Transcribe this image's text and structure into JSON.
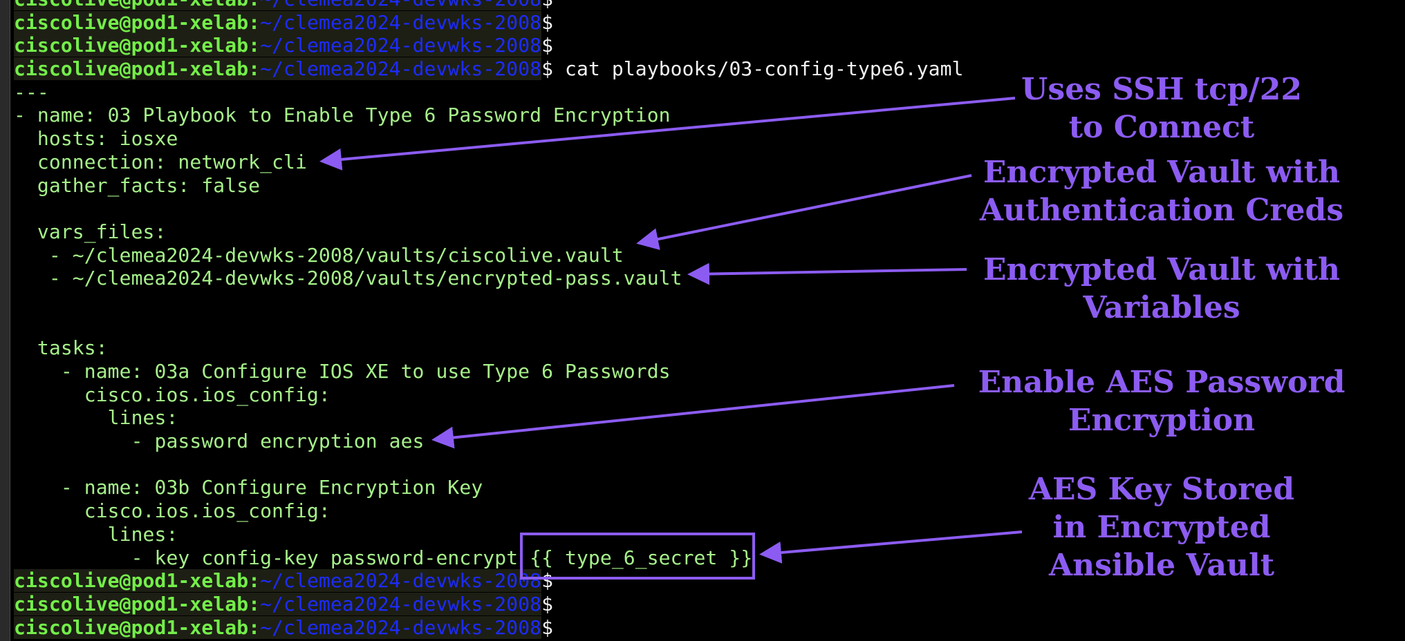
{
  "terminal": {
    "prompt": {
      "user": "ciscolive@pod1-xelab",
      "sep": ":",
      "path": "~/clemea2024-devwks-2008",
      "dollar": "$"
    },
    "command": " cat playbooks/03-config-type6.yaml",
    "file_lines": [
      "---",
      "- name: 03 Playbook to Enable Type 6 Password Encryption",
      "  hosts: iosxe",
      "  connection: network_cli",
      "  gather_facts: false",
      "",
      "  vars_files:",
      "   - ~/clemea2024-devwks-2008/vaults/ciscolive.vault",
      "   - ~/clemea2024-devwks-2008/vaults/encrypted-pass.vault",
      "",
      "",
      "  tasks:",
      "    - name: 03a Configure IOS XE to use Type 6 Passwords",
      "      cisco.ios.ios_config:",
      "        lines:",
      "          - password encryption aes",
      "",
      "    - name: 03b Configure Encryption Key",
      "      cisco.ios.ios_config:",
      "        lines:",
      "          - key config-key password-encrypt {{ type_6_secret }}"
    ]
  },
  "annotations": {
    "ssh": "Uses SSH tcp/22\nto Connect",
    "creds": "Encrypted Vault with\nAuthentication Creds",
    "vars": "Encrypted Vault with\nVariables",
    "aes": "Enable AES Password\nEncryption",
    "key": "AES Key Stored\nin Encrypted\nAnsible Vault"
  },
  "colors": {
    "annotation": "#8c5cf2",
    "terminal_text": "#a6f08a",
    "prompt_user": "#74ee4a",
    "prompt_path": "#1d2bff"
  }
}
